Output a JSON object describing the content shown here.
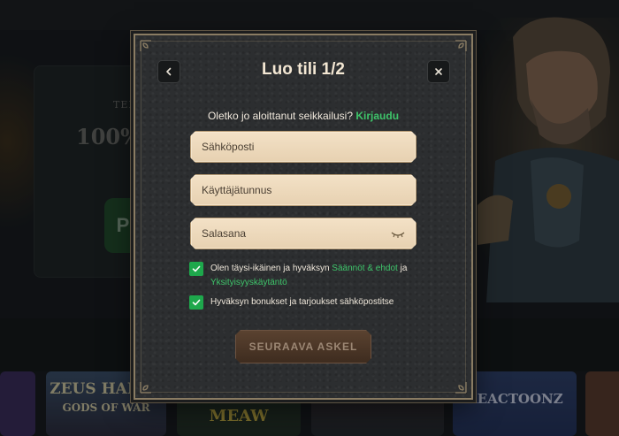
{
  "background": {
    "promo_small": "TER",
    "promo_big": "100%",
    "promo_button": "P",
    "tiles": [
      {
        "label": ""
      },
      {
        "label": "ZEUS HADES"
      },
      {
        "label": "GODS OF WAR"
      },
      {
        "label": "MEAW"
      },
      {
        "label": "REACTOONZ"
      }
    ]
  },
  "modal": {
    "title": "Luo tili 1/2",
    "back_icon": "chevron-left-icon",
    "close_icon": "close-icon",
    "login_prompt": "Oletko jo aloittanut seikkailusi?",
    "login_link": "Kirjaudu",
    "email_placeholder": "Sähköposti",
    "username_placeholder": "Käyttäjätunnus",
    "password_placeholder": "Salasana",
    "password_icon": "eye-closed-icon",
    "consent_age_prefix": "Olen täysi-ikäinen ja hyväksyn",
    "consent_terms_link": "Säännöt & ehdot",
    "consent_and": "ja",
    "consent_privacy_link": "Yksityisyyskäytäntö",
    "consent_marketing": "Hyväksyn bonukset ja tarjoukset sähköpostitse",
    "consent_age_checked": true,
    "consent_marketing_checked": true,
    "next_button": "SEURAAVA ASKEL"
  },
  "colors": {
    "accent_green": "#3ec46a",
    "checkbox_green": "#1ea84c",
    "field_bg": "#f3e1c6",
    "title_color": "#f3e7d3",
    "modal_bg": "#2c2e30",
    "button_bg": "#4a3526"
  }
}
